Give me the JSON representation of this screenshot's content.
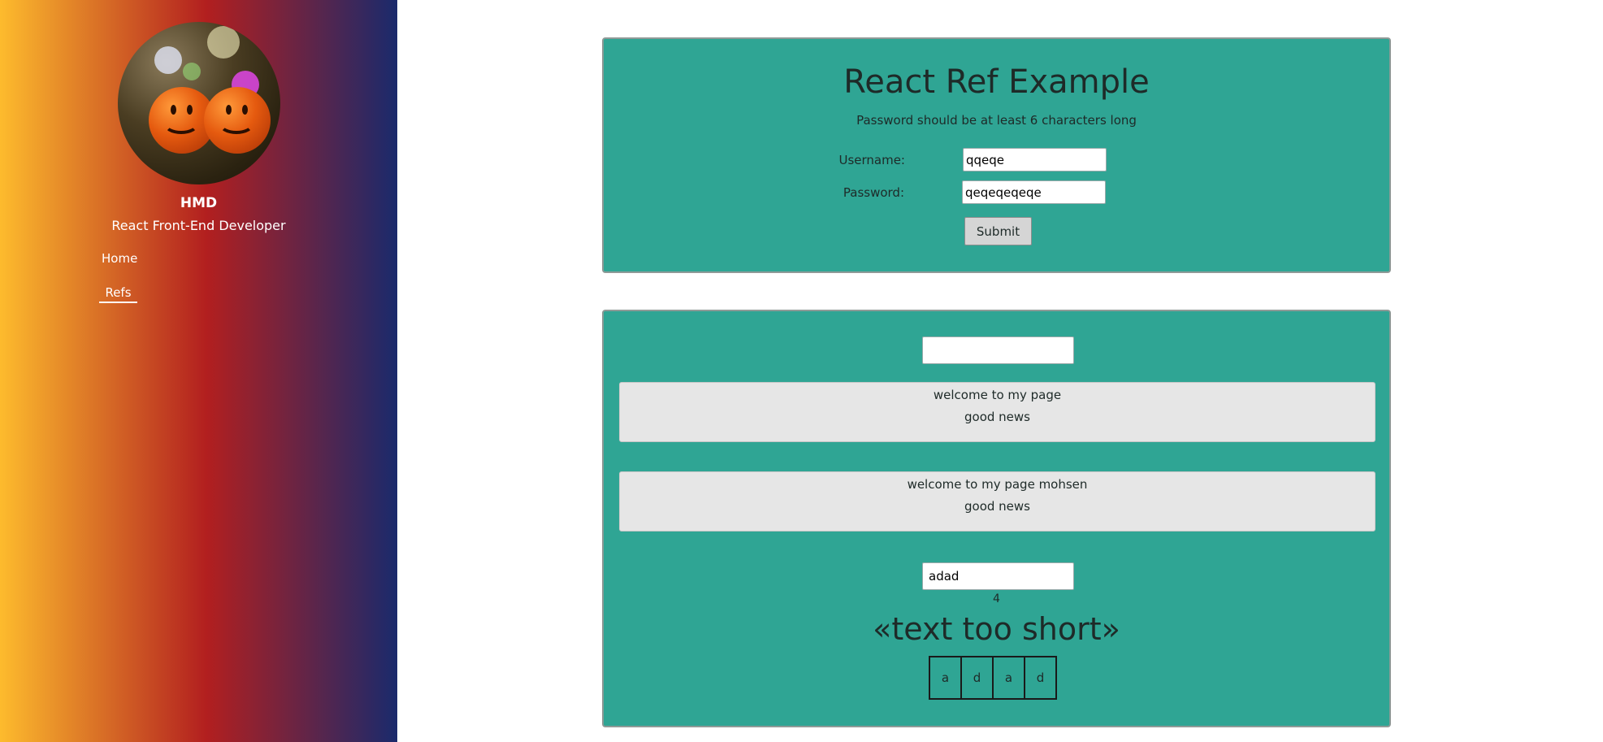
{
  "sidebar": {
    "name": "HMD",
    "role": "React Front-End Developer",
    "nav": [
      {
        "label": "Home",
        "active": false
      },
      {
        "label": "Refs",
        "active": true
      }
    ]
  },
  "ref_example": {
    "title": "React Ref Example",
    "subtitle": "Password should be at least 6 characters long",
    "username_label": "Username:",
    "username_value": "qqeqe",
    "password_label": "Password:",
    "password_value": "qeqeqeqeqe",
    "submit_label": "Submit"
  },
  "second_card": {
    "top_input_value": "",
    "messages": [
      {
        "line1": "welcome to my page",
        "line2": "good news"
      },
      {
        "line1": "welcome to my page mohsen",
        "line2": "good news"
      }
    ],
    "text_input_value": "adad",
    "char_count": "4",
    "status_message": "«text too short»",
    "characters": [
      "a",
      "d",
      "a",
      "d"
    ]
  },
  "colors": {
    "card_bg": "#2fa594",
    "gradient": [
      "#fdbb2d",
      "#b21f1f",
      "#1a2a6c"
    ],
    "message_bg": "#e6e6e6"
  }
}
